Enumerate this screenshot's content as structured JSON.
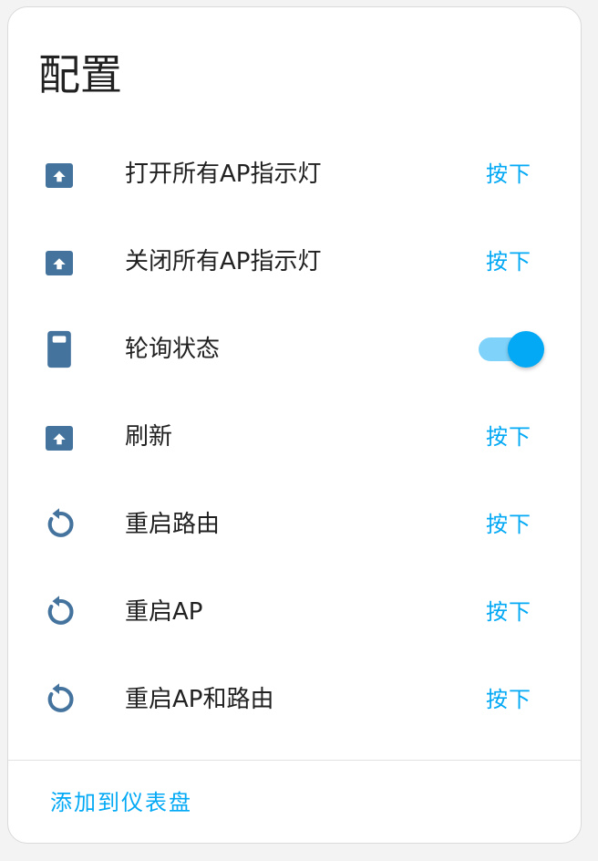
{
  "card": {
    "title": "配置",
    "rows": [
      {
        "label": "打开所有AP指示灯",
        "icon": "button-press-icon",
        "action": "按下"
      },
      {
        "label": "关闭所有AP指示灯",
        "icon": "button-press-icon",
        "action": "按下"
      },
      {
        "label": "轮询状态",
        "icon": "switch-icon",
        "toggle_on": true
      },
      {
        "label": "刷新",
        "icon": "button-press-icon",
        "action": "按下"
      },
      {
        "label": "重启路由",
        "icon": "restart-icon",
        "action": "按下"
      },
      {
        "label": "重启AP",
        "icon": "restart-icon",
        "action": "按下"
      },
      {
        "label": "重启AP和路由",
        "icon": "restart-icon",
        "action": "按下"
      }
    ],
    "footer_link": "添加到仪表盘"
  },
  "colors": {
    "accent": "#03a9f4",
    "icon": "#44739e",
    "text": "#212121"
  }
}
